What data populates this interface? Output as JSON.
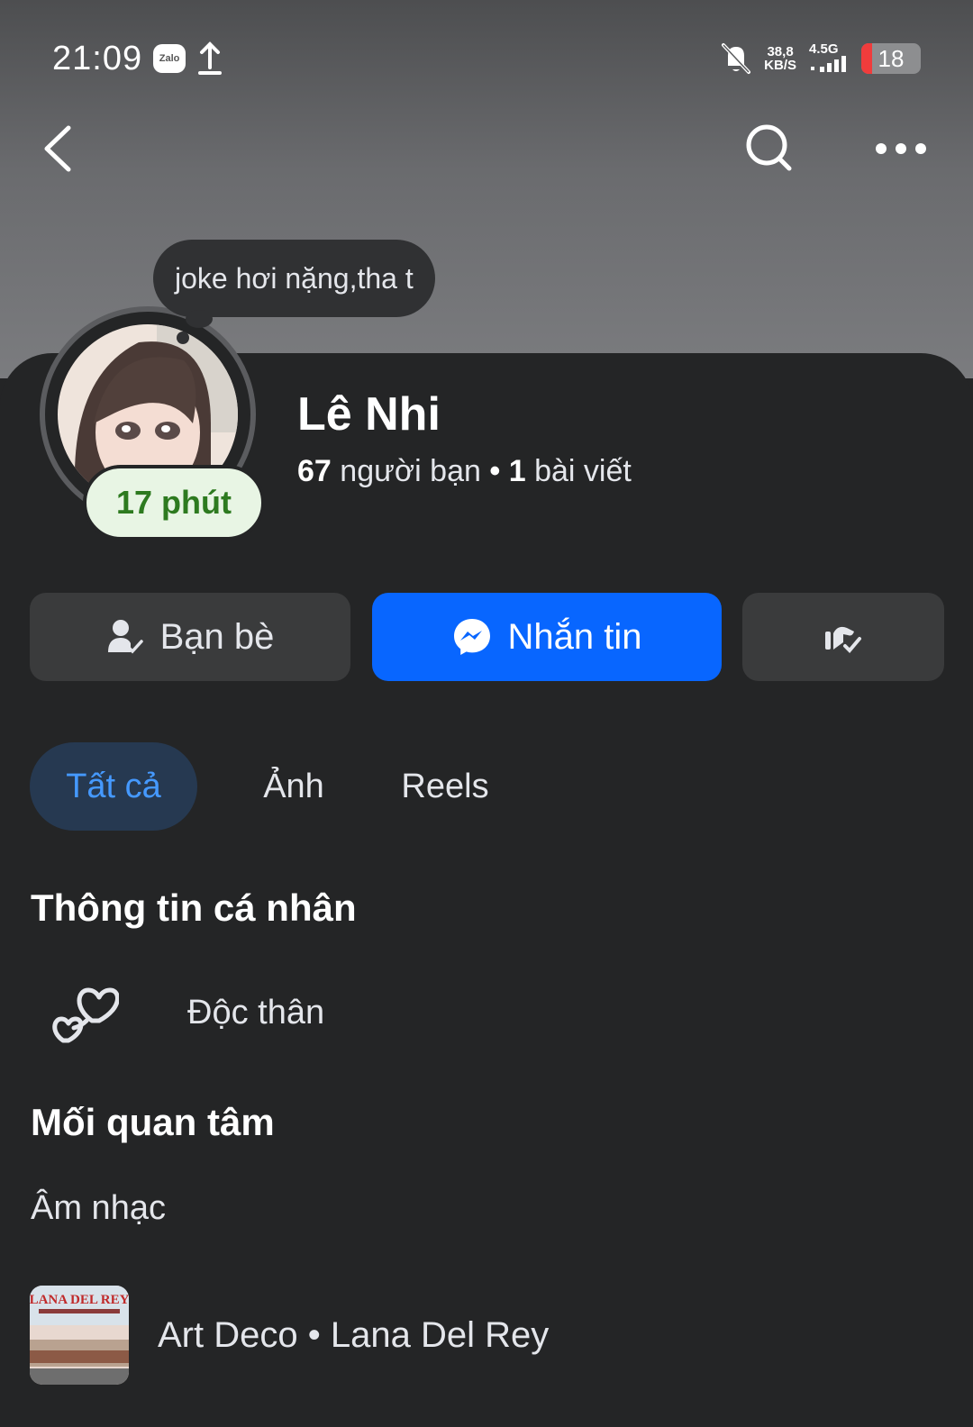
{
  "status_bar": {
    "time": "21:09",
    "app_badge": "Zalo",
    "speed_value": "38,8",
    "speed_unit": "KB/S",
    "network": "4.5G",
    "battery": "18",
    "battery_level": 0.18,
    "icons": [
      "zalo-icon",
      "upload-icon",
      "mute-bell-icon",
      "signal-icon",
      "battery-icon"
    ]
  },
  "nav": {
    "icons": [
      "back-icon",
      "search-icon",
      "more-icon"
    ]
  },
  "note": {
    "text": "joke hơi nặng,tha t"
  },
  "profile": {
    "active": "17 phút",
    "name": "Lê Nhi",
    "friends_count": "67",
    "friends_label": "người bạn",
    "separator": "•",
    "posts_count": "1",
    "posts_label": "bài viết"
  },
  "actions": {
    "friends_label": "Bạn bè",
    "message_label": "Nhắn tin",
    "message_color": "#0866ff",
    "icons": [
      "friend-check-icon",
      "messenger-icon",
      "wave-check-icon"
    ]
  },
  "tabs": [
    {
      "label": "Tất cả",
      "active": true
    },
    {
      "label": "Ảnh",
      "active": false
    },
    {
      "label": "Reels",
      "active": false
    }
  ],
  "personal_info": {
    "title": "Thông tin cá nhân",
    "relationship": "Độc thân",
    "icon": "hearts-icon"
  },
  "interests": {
    "title": "Mối quan tâm",
    "category": "Âm nhạc",
    "song": "Art Deco",
    "separator": "•",
    "artist": "Lana Del Rey",
    "album_text": "LANA DEL REY"
  }
}
